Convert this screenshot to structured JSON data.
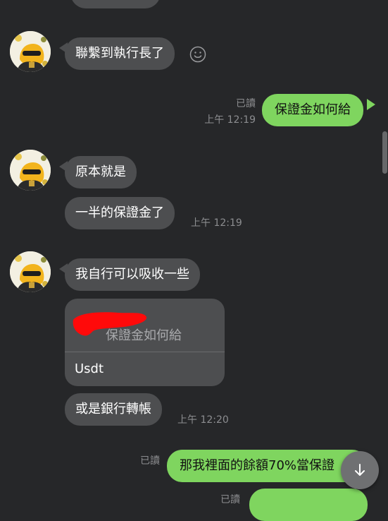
{
  "colors": {
    "background": "#262729",
    "incoming_bubble": "#4d4e50",
    "outgoing_bubble": "#7fd55f",
    "meta_text": "#8c8d90"
  },
  "messages": {
    "m1": {
      "text": "聯繫到執行長了"
    },
    "m2": {
      "text": "保證金如何給",
      "read": "已讀",
      "time": "上午 12:19"
    },
    "m3": {
      "text": "原本就是"
    },
    "m4": {
      "text": "一半的保證金了",
      "time": "上午 12:19"
    },
    "m5": {
      "text": "我自行可以吸收一些"
    },
    "m6": {
      "quoted_text": "保證金如何給",
      "reply_text": "Usdt"
    },
    "m7": {
      "text": "或是銀行轉帳",
      "time": "上午 12:20"
    },
    "m8": {
      "text": "那我裡面的餘額70%當保證",
      "read": "已讀"
    },
    "m9": {
      "read": "已讀"
    }
  },
  "icons": {
    "emoji_reaction": "smiley-icon",
    "scroll_down": "arrow-down-icon",
    "avatar": "cartoon-character-avatar"
  }
}
